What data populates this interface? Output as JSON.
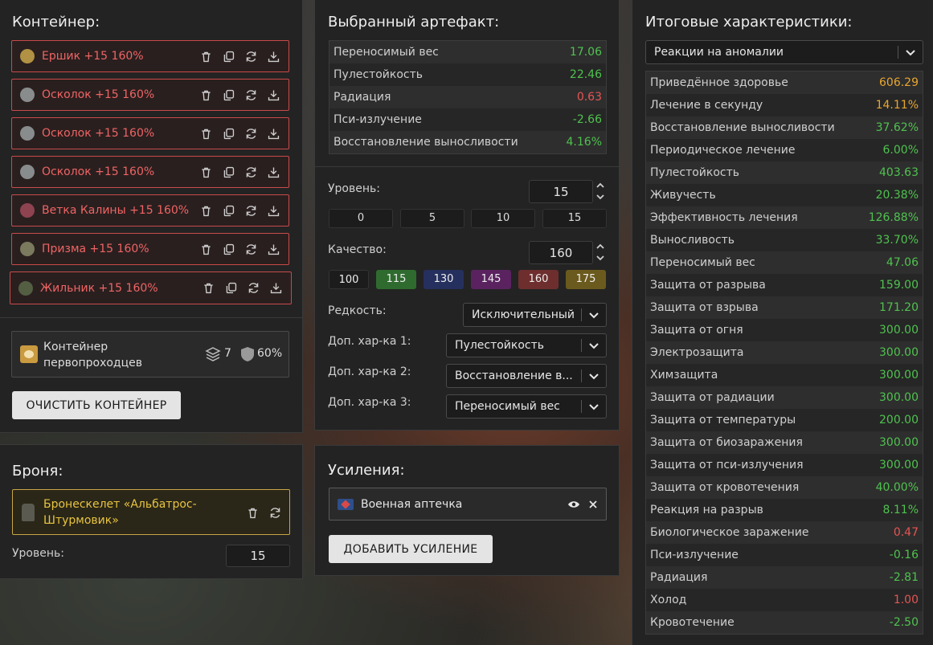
{
  "container": {
    "title": "Контейнер:",
    "slots": [
      {
        "name": "Ершик +15 160%"
      },
      {
        "name": "Осколок +15 160%"
      },
      {
        "name": "Осколок +15 160%"
      },
      {
        "name": "Осколок +15 160%"
      },
      {
        "name": "Ветка Калины +15 160%"
      },
      {
        "name": "Призма +15 160%"
      },
      {
        "name": "Жильник +15 160%"
      }
    ],
    "box": {
      "name_line1": "Контейнер",
      "name_line2": "первопроходцев",
      "capacity": "7",
      "protection": "60%"
    },
    "clear_label": "ОЧИСТИТЬ КОНТЕЙНЕР"
  },
  "armor": {
    "title": "Броня:",
    "name_line1": "Бронескелет «Альбатрос-",
    "name_line2": "Штурмовик»",
    "level_label": "Уровень:",
    "level": "15"
  },
  "artifact": {
    "title": "Выбранный артефакт:",
    "stats": [
      {
        "label": "Переносимый вес",
        "value": "17.06",
        "color": "#4fc24f"
      },
      {
        "label": "Пулестойкость",
        "value": "22.46",
        "color": "#4fc24f"
      },
      {
        "label": "Радиация",
        "value": "0.63",
        "color": "#e65454"
      },
      {
        "label": "Пси-излучение",
        "value": "-2.66",
        "color": "#4fc24f"
      },
      {
        "label": "Восстановление выносливости",
        "value": "4.16%",
        "color": "#4fc24f"
      }
    ],
    "level_label": "Уровень:",
    "level": "15",
    "level_presets": [
      "0",
      "5",
      "10",
      "15"
    ],
    "quality_label": "Качество:",
    "quality": "160",
    "quality_presets": [
      {
        "label": "100",
        "color": "#1c1c1c"
      },
      {
        "label": "115",
        "color": "#2f6b2f"
      },
      {
        "label": "130",
        "color": "#26305e"
      },
      {
        "label": "145",
        "color": "#5a2360"
      },
      {
        "label": "160",
        "color": "#6e2e2e"
      },
      {
        "label": "175",
        "color": "#6b5a1d"
      }
    ],
    "rarity_label": "Редкость:",
    "rarity": "Исключительный",
    "extra1_label": "Доп. хар-ка 1:",
    "extra1": "Пулестойкость",
    "extra2_label": "Доп. хар-ка 2:",
    "extra2": "Восстановление в...",
    "extra3_label": "Доп. хар-ка 3:",
    "extra3": "Переносимый вес"
  },
  "boosts": {
    "title": "Усиления:",
    "item": "Военная аптечка",
    "add_label": "ДОБАВИТЬ УСИЛЕНИЕ"
  },
  "totals": {
    "title": "Итоговые характеристики:",
    "filter": "Реакции на аномалии",
    "stats": [
      {
        "label": "Приведённое здоровье",
        "value": "606.29",
        "color": "#e8a630"
      },
      {
        "label": "Лечение в секунду",
        "value": "14.11%",
        "color": "#e8a630"
      },
      {
        "label": "Восстановление выносливости",
        "value": "37.62%",
        "color": "#4fc24f"
      },
      {
        "label": "Периодическое лечение",
        "value": "6.00%",
        "color": "#4fc24f"
      },
      {
        "label": "Пулестойкость",
        "value": "403.63",
        "color": "#4fc24f"
      },
      {
        "label": "Живучесть",
        "value": "20.38%",
        "color": "#4fc24f"
      },
      {
        "label": "Эффективность лечения",
        "value": "126.88%",
        "color": "#4fc24f"
      },
      {
        "label": "Выносливость",
        "value": "33.70%",
        "color": "#4fc24f"
      },
      {
        "label": "Переносимый вес",
        "value": "47.06",
        "color": "#4fc24f"
      },
      {
        "label": "Защита от разрыва",
        "value": "159.00",
        "color": "#4fc24f"
      },
      {
        "label": "Защита от взрыва",
        "value": "171.20",
        "color": "#4fc24f"
      },
      {
        "label": "Защита от огня",
        "value": "300.00",
        "color": "#4fc24f"
      },
      {
        "label": "Электрозащита",
        "value": "300.00",
        "color": "#4fc24f"
      },
      {
        "label": "Химзащита",
        "value": "300.00",
        "color": "#4fc24f"
      },
      {
        "label": "Защита от радиации",
        "value": "300.00",
        "color": "#4fc24f"
      },
      {
        "label": "Защита от температуры",
        "value": "200.00",
        "color": "#4fc24f"
      },
      {
        "label": "Защита от биозаражения",
        "value": "300.00",
        "color": "#4fc24f"
      },
      {
        "label": "Защита от пси-излучения",
        "value": "300.00",
        "color": "#4fc24f"
      },
      {
        "label": "Защита от кровотечения",
        "value": "40.00%",
        "color": "#4fc24f"
      },
      {
        "label": "Реакция на разрыв",
        "value": "8.11%",
        "color": "#4fc24f"
      },
      {
        "label": "Биологическое заражение",
        "value": "0.47",
        "color": "#e65454"
      },
      {
        "label": "Пси-излучение",
        "value": "-0.16",
        "color": "#4fc24f"
      },
      {
        "label": "Радиация",
        "value": "-2.81",
        "color": "#4fc24f"
      },
      {
        "label": "Холод",
        "value": "1.00",
        "color": "#e65454"
      },
      {
        "label": "Кровотечение",
        "value": "-2.50",
        "color": "#4fc24f"
      }
    ]
  }
}
